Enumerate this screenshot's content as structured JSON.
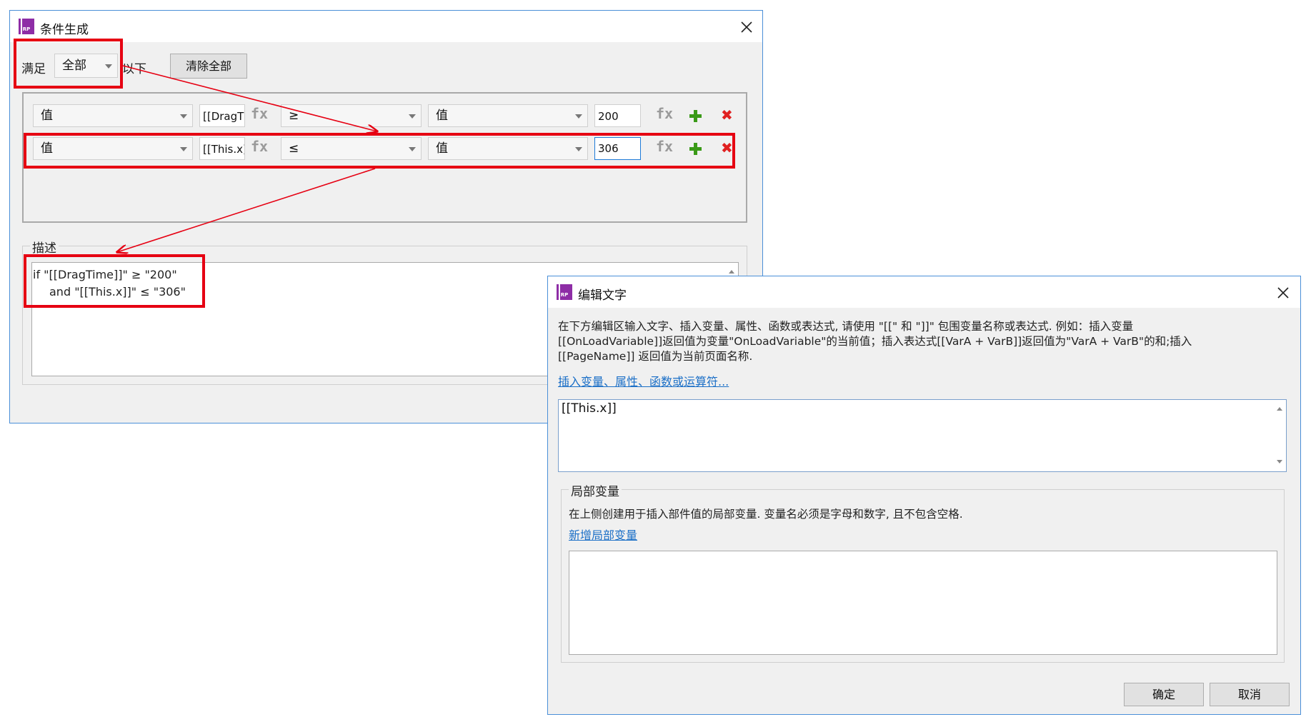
{
  "condition_dialog": {
    "icon_text": "RP",
    "title": "条件生成",
    "satisfy_label": "满足",
    "match_select": "全部",
    "below_label": "以下",
    "clear_all_button": "清除全部",
    "rows": [
      {
        "left_type": "值",
        "left_value": "[[DragTime]]",
        "operator": "≥",
        "right_type": "值",
        "right_value": "200"
      },
      {
        "left_type": "值",
        "left_value": "[[This.x]]",
        "operator": "≤",
        "right_type": "值",
        "right_value": "306"
      }
    ],
    "fx_label": "fx",
    "remove_label": "✖",
    "description_label": "描述",
    "description_line1": "if \"[[DragTime]]\" ≥ \"200\"",
    "description_line2": "and \"[[This.x]]\" ≤ \"306\""
  },
  "edit_dialog": {
    "icon_text": "RP",
    "title": "编辑文字",
    "instructions_line1": "在下方编辑区输入文字、插入变量、属性、函数或表达式, 请使用 \"[[\" 和 \"]]\" 包围变量名称或表达式. 例如：插入变量",
    "instructions_line2": "[[OnLoadVariable]]返回值为变量\"OnLoadVariable\"的当前值；插入表达式[[VarA + VarB]]返回值为\"VarA + VarB\"的和;插入",
    "instructions_line3": "[[PageName]] 返回值为当前页面名称.",
    "insert_link": "插入变量、属性、函数或运算符...",
    "editor_text": "[[This.x]]",
    "local_vars_label": "局部变量",
    "local_vars_desc": "在上侧创建用于插入部件值的局部变量. 变量名必须是字母和数字, 且不包含空格.",
    "add_local_var_link": "新增局部变量",
    "ok_button": "确定",
    "cancel_button": "取消"
  },
  "colors": {
    "highlight": "#e60012",
    "dialog_border": "#4a8fd8",
    "link": "#1b6fc7",
    "add_green": "#3a9a18",
    "remove_red": "#e02020",
    "app_icon": "#8e2da6"
  }
}
